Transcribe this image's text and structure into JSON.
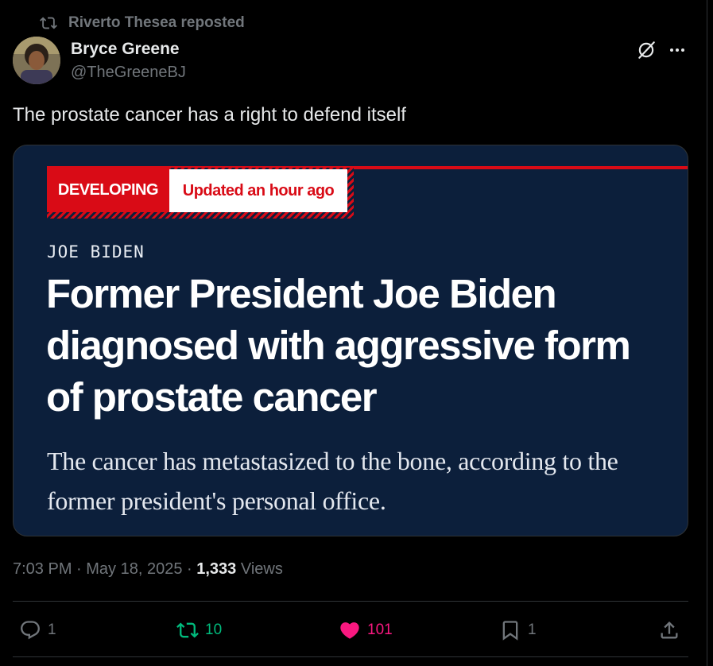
{
  "context": {
    "reposted_by": "Riverto Thesea reposted",
    "icon": "repost-icon"
  },
  "author": {
    "name": "Bryce Greene",
    "handle": "@TheGreeneBJ"
  },
  "header_icons": [
    "grok-icon",
    "more-icon"
  ],
  "tweet": {
    "text": "The prostate cancer has a right to defend itself"
  },
  "media": {
    "badge_label": "DEVELOPING",
    "badge_time": "Updated an hour ago",
    "kicker": "JOE BIDEN",
    "headline": "Former President Joe Biden diagnosed with aggressive form of prostate cancer",
    "dek": "The cancer has metastasized to the bone, according to the former president's personal office."
  },
  "meta": {
    "time": "7:03 PM",
    "date": "May 18, 2025",
    "views_count": "1,333",
    "views_label": "Views"
  },
  "actions": {
    "replies": "1",
    "reposts": "10",
    "likes": "101",
    "bookmarks": "1"
  },
  "colors": {
    "background": "#000000",
    "repost_active": "#00ba7c",
    "like_active": "#f91880",
    "card_bg": "#0c1f3b",
    "badge_red": "#d90b16"
  }
}
